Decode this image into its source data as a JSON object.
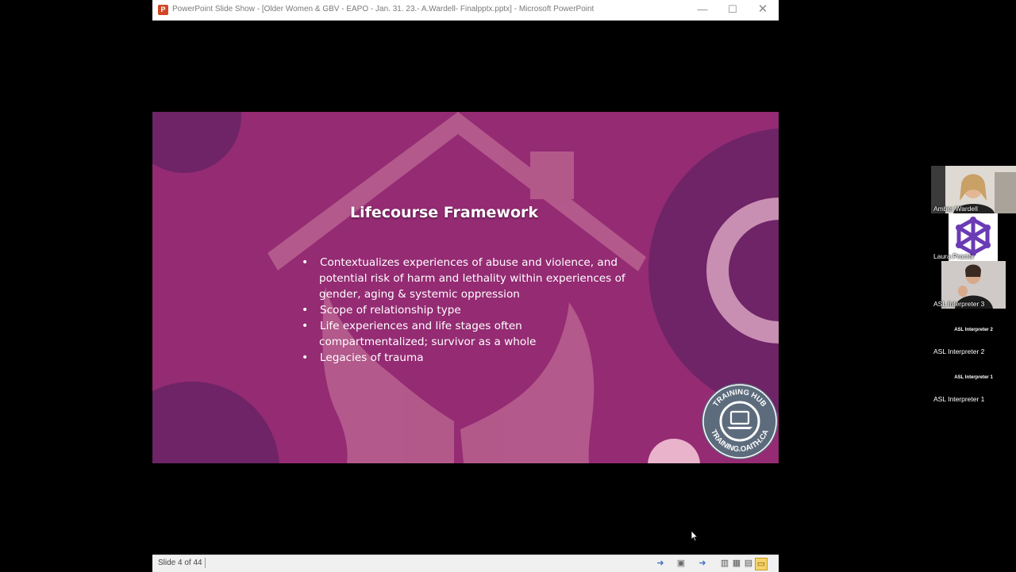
{
  "window": {
    "title": "PowerPoint Slide Show - [Older Women & GBV - EAPO - Jan. 31. 23.- A.Wardell- Finalpptx.pptx] - Microsoft PowerPoint",
    "app_icon_glyph": "P",
    "controls": {
      "minimize": "—",
      "maximize": "☐",
      "close": "✕"
    }
  },
  "slide": {
    "title": "Lifecourse Framework",
    "bullets": [
      {
        "lines": [
          "Contextualizes experiences of abuse and violence, and",
          "potential risk of harm and lethality within experiences of",
          "gender, aging & systemic oppression"
        ]
      },
      {
        "lines": [
          "Scope of relationship type"
        ]
      },
      {
        "lines": [
          "Life experiences and life stages often",
          "compartmentalized; survivor as a whole"
        ]
      },
      {
        "lines": [
          "Legacies of trauma"
        ]
      }
    ],
    "badge": {
      "top_text": "TRAINING HUB",
      "bottom_text": "TRAINING.OAITH.CA",
      "icon": "laptop-icon"
    },
    "colors": {
      "background": "#942b73",
      "accent_dark": "#6e2467",
      "accent_light": "#b9628f"
    }
  },
  "status_bar": {
    "slide_counter": "Slide 4 of 44",
    "icons": [
      "previous-arrow-icon",
      "slide-menu-icon",
      "next-arrow-icon",
      "normal-view-icon",
      "slide-sorter-icon",
      "reading-view-icon",
      "slide-show-icon"
    ]
  },
  "participants": [
    {
      "name": "Amber Wardell",
      "kind": "video"
    },
    {
      "name": "Laura Proctor",
      "kind": "logo"
    },
    {
      "name": "ASL Interpreter 3",
      "kind": "video"
    },
    {
      "name": "ASL Interpreter 2",
      "kind": "placeholder",
      "center_label": "ASL Interpreter 2"
    },
    {
      "name": "ASL Interpreter 1",
      "kind": "placeholder",
      "center_label": "ASL Interpreter 1"
    }
  ]
}
